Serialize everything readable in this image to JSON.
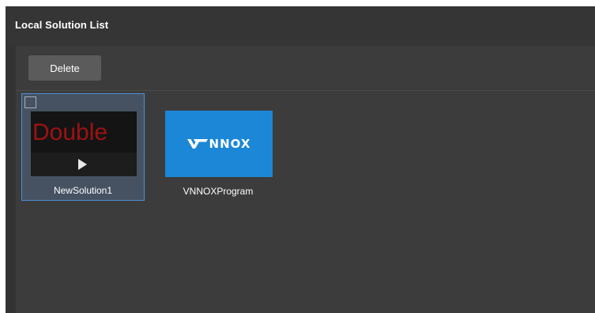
{
  "panel": {
    "title": "Local Solution List"
  },
  "toolbar": {
    "delete_label": "Delete"
  },
  "solutions": [
    {
      "name": "NewSolution1",
      "thumbnail_text": "Double",
      "selected": true,
      "checked": false,
      "icon": "play-icon"
    },
    {
      "name": "VNNOXProgram",
      "thumbnail_text": "NNOX",
      "selected": false,
      "icon": "vnnox-logo"
    }
  ],
  "colors": {
    "panel_bg": "#333333",
    "content_bg": "#3c3c3c",
    "selection_border": "#4d8fd6",
    "selection_bg": "#465262",
    "button_bg": "#5b5b5b",
    "vnnox_blue": "#1b87d6",
    "double_text": "#9e1212"
  }
}
